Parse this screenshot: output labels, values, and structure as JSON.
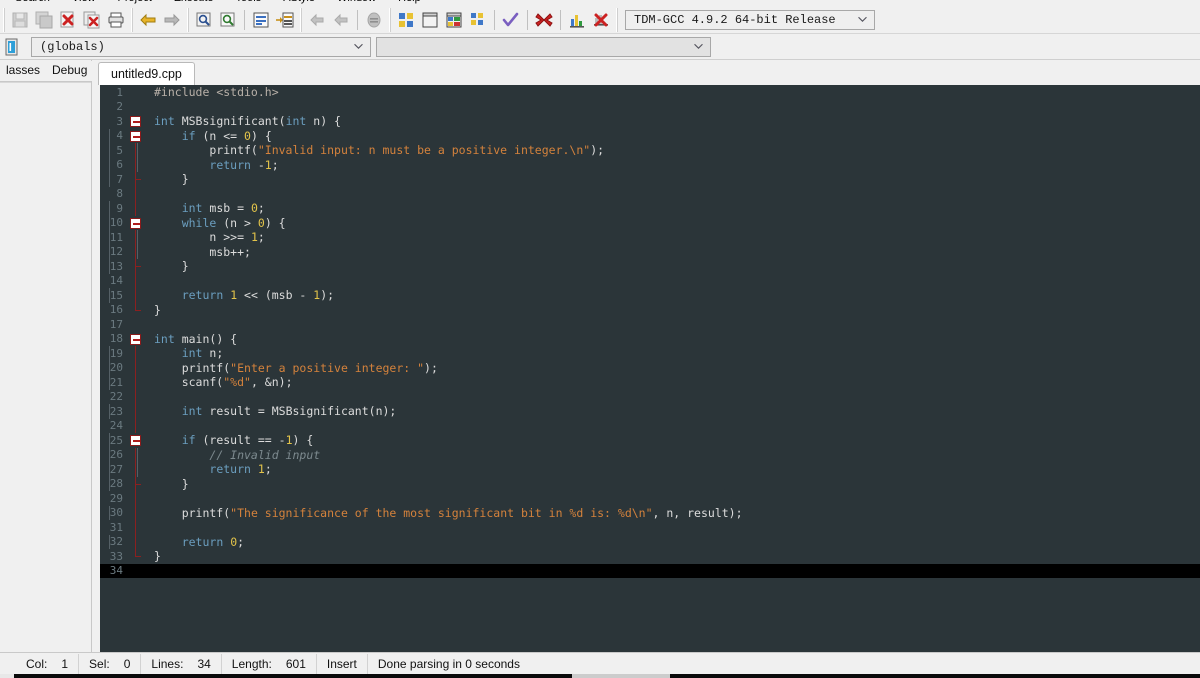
{
  "menu": {
    "items": [
      "Search",
      "View",
      "Project",
      "Execute",
      "Tools",
      "AStyle",
      "Window",
      "Help"
    ]
  },
  "toolbar": {
    "groups": [
      {
        "buttons": [
          {
            "name": "save-icon",
            "label": "Save",
            "enabled": false
          },
          {
            "name": "save-all-icon",
            "label": "Save All",
            "enabled": false
          },
          {
            "name": "close-file-icon",
            "label": "Close",
            "enabled": true
          },
          {
            "name": "close-all-icon",
            "label": "Close All",
            "enabled": true
          },
          {
            "name": "print-icon",
            "label": "Print",
            "enabled": true
          }
        ]
      },
      {
        "buttons": [
          {
            "name": "undo-icon",
            "label": "Undo",
            "enabled": true
          },
          {
            "name": "redo-icon",
            "label": "Redo",
            "enabled": false
          }
        ]
      },
      {
        "buttons": [
          {
            "name": "find-icon",
            "label": "Find",
            "enabled": true
          },
          {
            "name": "find-next-icon",
            "label": "Find Next",
            "enabled": true
          },
          {
            "name": "goto-line-icon",
            "label": "Goto Line",
            "enabled": true
          },
          {
            "name": "goto-function-icon",
            "label": "Goto Function",
            "enabled": true
          }
        ]
      },
      {
        "buttons": [
          {
            "name": "back-icon",
            "label": "Back",
            "enabled": false
          },
          {
            "name": "forward-icon",
            "label": "Forward",
            "enabled": false
          },
          {
            "name": "breakpoint-icon",
            "label": "Toggle Breakpoint",
            "enabled": false
          }
        ]
      },
      {
        "buttons": [
          {
            "name": "compile-icon",
            "label": "Compile",
            "enabled": true
          },
          {
            "name": "run-icon",
            "label": "Run",
            "enabled": true
          },
          {
            "name": "compile-run-icon",
            "label": "Compile & Run",
            "enabled": true
          },
          {
            "name": "rebuild-icon",
            "label": "Rebuild All",
            "enabled": true
          },
          {
            "name": "syntax-check-icon",
            "label": "Syntax Check",
            "enabled": true
          },
          {
            "name": "stop-icon",
            "label": "Stop Execution",
            "enabled": true
          },
          {
            "name": "profile-icon",
            "label": "Profile Analysis",
            "enabled": true
          },
          {
            "name": "delete-profile-icon",
            "label": "Delete Profile",
            "enabled": true
          }
        ]
      }
    ],
    "compiler_select": {
      "value": "TDM-GCC 4.9.2 64-bit Release",
      "name": "compiler-set-dropdown"
    }
  },
  "scopebar": {
    "class_browser_icon": "class-browser-icon",
    "scope_select": {
      "value": "(globals)",
      "name": "scope-dropdown"
    },
    "member_select": {
      "value": "",
      "name": "member-dropdown"
    }
  },
  "leftpanel": {
    "tabs": [
      {
        "label": "lasses",
        "name": "panel-tab-classes",
        "active": false
      },
      {
        "label": "Debug",
        "name": "panel-tab-debug",
        "active": false
      }
    ]
  },
  "editor": {
    "tabs": [
      {
        "label": "untitled9.cpp",
        "active": true
      }
    ],
    "theme": {
      "background": "#2b3539",
      "gutter_text": "#6b7a80",
      "default_text": "#dcdcdc",
      "keyword": "#6b9ebf",
      "string": "#d4823c",
      "number": "#e3c44a",
      "comment": "#7d8a8f",
      "preprocessor": "#b8b0a8",
      "current_line": "#000000",
      "fold_marker": "#b01c1c"
    },
    "current_line": 34,
    "lines": [
      {
        "num": 1,
        "fold": "none",
        "tokens": [
          {
            "t": "#include ",
            "c": "p"
          },
          {
            "t": "<stdio.h>",
            "c": "p"
          }
        ]
      },
      {
        "num": 2,
        "fold": "none",
        "tokens": []
      },
      {
        "num": 3,
        "fold": "open",
        "tokens": [
          {
            "t": "int",
            "c": "k"
          },
          {
            "t": " MSBsignificant(",
            "c": "id"
          },
          {
            "t": "int",
            "c": "k"
          },
          {
            "t": " n) {",
            "c": "id"
          }
        ]
      },
      {
        "num": 4,
        "fold": "open",
        "indent": 1,
        "tokens": [
          {
            "t": "    ",
            "c": "id"
          },
          {
            "t": "if",
            "c": "k"
          },
          {
            "t": " (n <= ",
            "c": "id"
          },
          {
            "t": "0",
            "c": "n"
          },
          {
            "t": ") {",
            "c": "id"
          }
        ]
      },
      {
        "num": 5,
        "fold": "bar",
        "indent": 2,
        "tokens": [
          {
            "t": "        printf(",
            "c": "id"
          },
          {
            "t": "\"Invalid input: n must be a positive integer.\\n\"",
            "c": "s"
          },
          {
            "t": ");",
            "c": "id"
          }
        ]
      },
      {
        "num": 6,
        "fold": "bar",
        "indent": 2,
        "tokens": [
          {
            "t": "        ",
            "c": "id"
          },
          {
            "t": "return",
            "c": "k"
          },
          {
            "t": " -",
            "c": "id"
          },
          {
            "t": "1",
            "c": "n"
          },
          {
            "t": ";",
            "c": "id"
          }
        ]
      },
      {
        "num": 7,
        "fold": "barend",
        "indent": 1,
        "tokens": [
          {
            "t": "    }",
            "c": "id"
          }
        ]
      },
      {
        "num": 8,
        "fold": "bar",
        "tokens": []
      },
      {
        "num": 9,
        "fold": "bar",
        "indent": 1,
        "tokens": [
          {
            "t": "    ",
            "c": "id"
          },
          {
            "t": "int",
            "c": "k"
          },
          {
            "t": " msb = ",
            "c": "id"
          },
          {
            "t": "0",
            "c": "n"
          },
          {
            "t": ";",
            "c": "id"
          }
        ]
      },
      {
        "num": 10,
        "fold": "open",
        "indent": 1,
        "tokens": [
          {
            "t": "    ",
            "c": "id"
          },
          {
            "t": "while",
            "c": "k"
          },
          {
            "t": " (n > ",
            "c": "id"
          },
          {
            "t": "0",
            "c": "n"
          },
          {
            "t": ") {",
            "c": "id"
          }
        ]
      },
      {
        "num": 11,
        "fold": "bar",
        "indent": 2,
        "tokens": [
          {
            "t": "        n >>= ",
            "c": "id"
          },
          {
            "t": "1",
            "c": "n"
          },
          {
            "t": ";",
            "c": "id"
          }
        ]
      },
      {
        "num": 12,
        "fold": "bar",
        "indent": 2,
        "tokens": [
          {
            "t": "        msb++;",
            "c": "id"
          }
        ]
      },
      {
        "num": 13,
        "fold": "barend",
        "indent": 1,
        "tokens": [
          {
            "t": "    }",
            "c": "id"
          }
        ]
      },
      {
        "num": 14,
        "fold": "bar",
        "tokens": []
      },
      {
        "num": 15,
        "fold": "bar",
        "indent": 1,
        "tokens": [
          {
            "t": "    ",
            "c": "id"
          },
          {
            "t": "return",
            "c": "k"
          },
          {
            "t": " ",
            "c": "id"
          },
          {
            "t": "1",
            "c": "n"
          },
          {
            "t": " << (msb - ",
            "c": "id"
          },
          {
            "t": "1",
            "c": "n"
          },
          {
            "t": ");",
            "c": "id"
          }
        ]
      },
      {
        "num": 16,
        "fold": "close",
        "tokens": [
          {
            "t": "}",
            "c": "id"
          }
        ]
      },
      {
        "num": 17,
        "fold": "none",
        "tokens": []
      },
      {
        "num": 18,
        "fold": "open",
        "tokens": [
          {
            "t": "int",
            "c": "k"
          },
          {
            "t": " main() {",
            "c": "id"
          }
        ]
      },
      {
        "num": 19,
        "fold": "bar",
        "indent": 1,
        "tokens": [
          {
            "t": "    ",
            "c": "id"
          },
          {
            "t": "int",
            "c": "k"
          },
          {
            "t": " n;",
            "c": "id"
          }
        ]
      },
      {
        "num": 20,
        "fold": "bar",
        "indent": 1,
        "tokens": [
          {
            "t": "    printf(",
            "c": "id"
          },
          {
            "t": "\"Enter a positive integer: \"",
            "c": "s"
          },
          {
            "t": ");",
            "c": "id"
          }
        ]
      },
      {
        "num": 21,
        "fold": "bar",
        "indent": 1,
        "tokens": [
          {
            "t": "    scanf(",
            "c": "id"
          },
          {
            "t": "\"%d\"",
            "c": "s"
          },
          {
            "t": ", &n);",
            "c": "id"
          }
        ]
      },
      {
        "num": 22,
        "fold": "bar",
        "tokens": []
      },
      {
        "num": 23,
        "fold": "bar",
        "indent": 1,
        "tokens": [
          {
            "t": "    ",
            "c": "id"
          },
          {
            "t": "int",
            "c": "k"
          },
          {
            "t": " result = MSBsignificant(n);",
            "c": "id"
          }
        ]
      },
      {
        "num": 24,
        "fold": "bar",
        "tokens": []
      },
      {
        "num": 25,
        "fold": "open",
        "indent": 1,
        "tokens": [
          {
            "t": "    ",
            "c": "id"
          },
          {
            "t": "if",
            "c": "k"
          },
          {
            "t": " (result == -",
            "c": "id"
          },
          {
            "t": "1",
            "c": "n"
          },
          {
            "t": ") {",
            "c": "id"
          }
        ]
      },
      {
        "num": 26,
        "fold": "bar",
        "indent": 2,
        "tokens": [
          {
            "t": "        ",
            "c": "id"
          },
          {
            "t": "// Invalid input",
            "c": "c"
          }
        ]
      },
      {
        "num": 27,
        "fold": "bar",
        "indent": 2,
        "tokens": [
          {
            "t": "        ",
            "c": "id"
          },
          {
            "t": "return",
            "c": "k"
          },
          {
            "t": " ",
            "c": "id"
          },
          {
            "t": "1",
            "c": "n"
          },
          {
            "t": ";",
            "c": "id"
          }
        ]
      },
      {
        "num": 28,
        "fold": "barend",
        "indent": 1,
        "tokens": [
          {
            "t": "    }",
            "c": "id"
          }
        ]
      },
      {
        "num": 29,
        "fold": "bar",
        "tokens": []
      },
      {
        "num": 30,
        "fold": "bar",
        "indent": 1,
        "tokens": [
          {
            "t": "    printf(",
            "c": "id"
          },
          {
            "t": "\"The significance of the most significant bit in %d is: %d\\n\"",
            "c": "s"
          },
          {
            "t": ", n, result);",
            "c": "id"
          }
        ]
      },
      {
        "num": 31,
        "fold": "bar",
        "tokens": []
      },
      {
        "num": 32,
        "fold": "bar",
        "indent": 1,
        "tokens": [
          {
            "t": "    ",
            "c": "id"
          },
          {
            "t": "return",
            "c": "k"
          },
          {
            "t": " ",
            "c": "id"
          },
          {
            "t": "0",
            "c": "n"
          },
          {
            "t": ";",
            "c": "id"
          }
        ]
      },
      {
        "num": 33,
        "fold": "close",
        "tokens": [
          {
            "t": "}",
            "c": "id"
          }
        ]
      },
      {
        "num": 34,
        "fold": "none",
        "tokens": []
      }
    ]
  },
  "statusbar": {
    "cells": [
      {
        "label": "Col:",
        "value": "1",
        "name": "status-col"
      },
      {
        "label": "Sel:",
        "value": "0",
        "name": "status-sel"
      },
      {
        "label": "Lines:",
        "value": "34",
        "name": "status-lines"
      },
      {
        "label": "Length:",
        "value": "601",
        "name": "status-length"
      }
    ],
    "insert_mode": "Insert",
    "parse_message": "Done parsing in 0 seconds"
  }
}
